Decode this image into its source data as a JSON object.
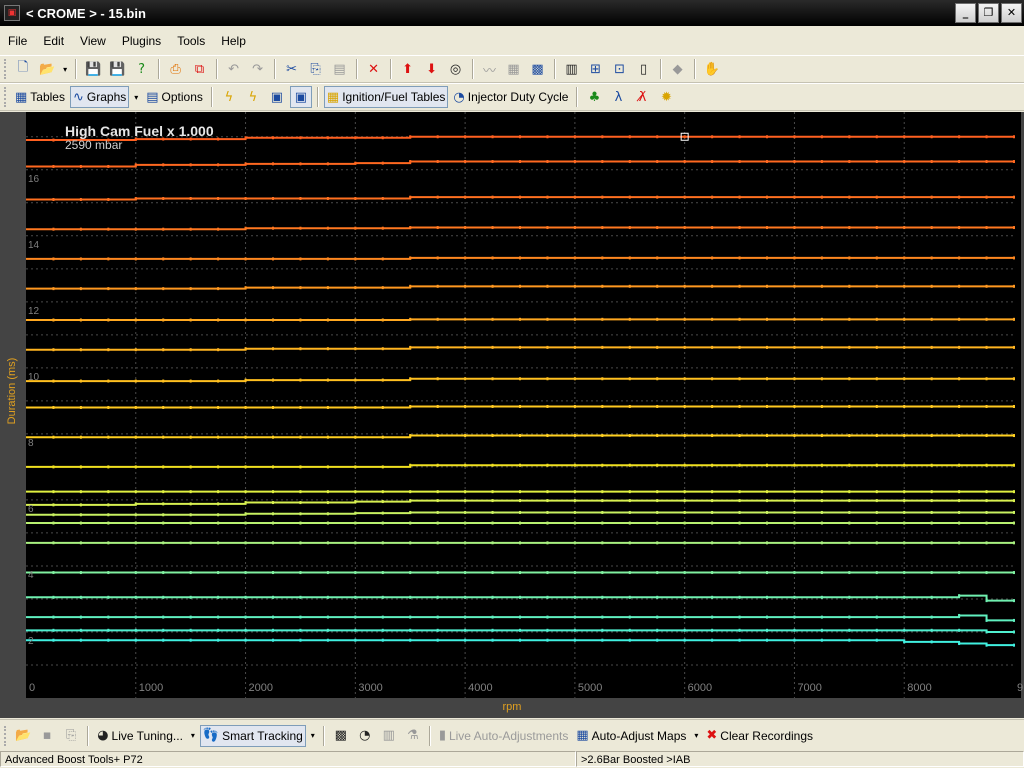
{
  "window": {
    "title": "< CROME > - 15.bin",
    "app_icon": "crome-app-icon",
    "buttons": [
      "_",
      "❐",
      "✕"
    ]
  },
  "menu": [
    "File",
    "Edit",
    "View",
    "Plugins",
    "Tools",
    "Help"
  ],
  "toolbar1": {
    "icons": [
      "new-file-icon",
      "open-folder-icon",
      "save-icon",
      "save-as-icon",
      "help-save-icon",
      "export-icon",
      "new-window-icon",
      "undo-icon",
      "redo-icon",
      "cut-icon",
      "copy-icon",
      "paste-icon",
      "delete-icon",
      "increase-icon",
      "decrease-icon",
      "target-icon",
      "smooth-icon",
      "interpolate-icon",
      "grid-icon",
      "chip-icon",
      "burn-icon",
      "emulate-icon",
      "checksum-icon",
      "eraser-icon",
      "hand-icon"
    ]
  },
  "toolbar2": {
    "tables_label": "Tables",
    "graphs_label": "Graphs",
    "options_label": "Options",
    "ignition_fuel_label": "Ignition/Fuel Tables",
    "injector_duty_label": "Injector Duty Cycle"
  },
  "graph": {
    "title": "High Cam Fuel x 1.000",
    "subtitle": "2590 mbar",
    "ylabel": "Duration (ms)",
    "xlabel": "rpm",
    "background": "#000000",
    "gridline_color": "#4a4a4a",
    "axis_label_color": "#e0a020",
    "tick_label_color": "#808080",
    "selected_marker_color": "#ffffff"
  },
  "chart_data": {
    "type": "line",
    "title": "High Cam Fuel x 1.000",
    "subtitle": "2590 mbar",
    "xlabel": "rpm",
    "ylabel": "Duration (ms)",
    "xlim": [
      0,
      9000
    ],
    "ylim": [
      0,
      17.5
    ],
    "x_ticks": [
      "0",
      "1000",
      "2000",
      "3000",
      "4000",
      "5000",
      "6000",
      "7000",
      "8000",
      "9"
    ],
    "y_ticks": [
      "2",
      "4",
      "6",
      "8",
      "10",
      "12",
      "14",
      "16"
    ],
    "grid": true,
    "x": [
      0,
      250,
      500,
      750,
      1000,
      1250,
      1500,
      1750,
      2000,
      2250,
      2500,
      2750,
      3000,
      3250,
      3500,
      3750,
      4000,
      4250,
      4500,
      4750,
      5000,
      5250,
      5500,
      5750,
      6000,
      6250,
      6500,
      6750,
      7000,
      7250,
      7500,
      7750,
      8000,
      8250,
      8500,
      8750,
      9000
    ],
    "series": [
      {
        "color": "#ff6020",
        "values": [
          16.9,
          16.9,
          16.9,
          16.9,
          16.93,
          16.93,
          16.93,
          16.93,
          16.97,
          16.97,
          16.97,
          16.97,
          16.97,
          16.97,
          17.0,
          17.0,
          17.0,
          17.0,
          17.0,
          17.0,
          17.0,
          17.0,
          17.0,
          17.0,
          17.0,
          17.0,
          17.0,
          17.0,
          17.0,
          17.0,
          17.0,
          17.0,
          17.0,
          17.0,
          17.0,
          17.0,
          17.0
        ]
      },
      {
        "color": "#ff6820",
        "values": [
          16.1,
          16.1,
          16.1,
          16.1,
          16.15,
          16.15,
          16.15,
          16.15,
          16.18,
          16.18,
          16.18,
          16.18,
          16.2,
          16.2,
          16.25,
          16.25,
          16.25,
          16.25,
          16.25,
          16.25,
          16.25,
          16.25,
          16.25,
          16.25,
          16.25,
          16.25,
          16.25,
          16.25,
          16.25,
          16.25,
          16.25,
          16.25,
          16.25,
          16.25,
          16.25,
          16.25,
          16.25
        ]
      },
      {
        "color": "#ff7020",
        "values": [
          15.1,
          15.1,
          15.1,
          15.1,
          15.13,
          15.13,
          15.13,
          15.13,
          15.13,
          15.13,
          15.13,
          15.13,
          15.13,
          15.13,
          15.17,
          15.17,
          15.17,
          15.17,
          15.17,
          15.17,
          15.17,
          15.17,
          15.17,
          15.17,
          15.17,
          15.17,
          15.17,
          15.17,
          15.17,
          15.17,
          15.17,
          15.17,
          15.17,
          15.17,
          15.17,
          15.17,
          15.17
        ]
      },
      {
        "color": "#ff7820",
        "values": [
          14.2,
          14.2,
          14.2,
          14.2,
          14.2,
          14.2,
          14.2,
          14.2,
          14.23,
          14.23,
          14.23,
          14.23,
          14.23,
          14.23,
          14.25,
          14.25,
          14.25,
          14.25,
          14.25,
          14.25,
          14.25,
          14.25,
          14.25,
          14.25,
          14.25,
          14.25,
          14.25,
          14.25,
          14.25,
          14.25,
          14.25,
          14.25,
          14.25,
          14.25,
          14.25,
          14.25,
          14.25
        ]
      },
      {
        "color": "#ff8820",
        "values": [
          13.3,
          13.3,
          13.3,
          13.3,
          13.3,
          13.3,
          13.3,
          13.3,
          13.3,
          13.3,
          13.3,
          13.3,
          13.3,
          13.3,
          13.33,
          13.33,
          13.33,
          13.33,
          13.33,
          13.33,
          13.33,
          13.33,
          13.33,
          13.33,
          13.33,
          13.33,
          13.33,
          13.33,
          13.33,
          13.33,
          13.33,
          13.33,
          13.33,
          13.33,
          13.33,
          13.33,
          13.33
        ]
      },
      {
        "color": "#ff9820",
        "values": [
          12.4,
          12.4,
          12.4,
          12.4,
          12.4,
          12.4,
          12.4,
          12.4,
          12.43,
          12.43,
          12.43,
          12.43,
          12.43,
          12.43,
          12.47,
          12.47,
          12.47,
          12.47,
          12.47,
          12.47,
          12.47,
          12.47,
          12.47,
          12.47,
          12.47,
          12.47,
          12.47,
          12.47,
          12.47,
          12.47,
          12.47,
          12.47,
          12.47,
          12.47,
          12.47,
          12.47,
          12.47
        ]
      },
      {
        "color": "#ffa820",
        "values": [
          11.45,
          11.45,
          11.45,
          11.45,
          11.45,
          11.45,
          11.45,
          11.45,
          11.45,
          11.45,
          11.45,
          11.45,
          11.45,
          11.45,
          11.47,
          11.47,
          11.47,
          11.47,
          11.47,
          11.47,
          11.47,
          11.47,
          11.47,
          11.47,
          11.47,
          11.47,
          11.47,
          11.47,
          11.47,
          11.47,
          11.47,
          11.47,
          11.47,
          11.47,
          11.47,
          11.47,
          11.47
        ]
      },
      {
        "color": "#ffb420",
        "values": [
          10.55,
          10.55,
          10.55,
          10.55,
          10.55,
          10.55,
          10.55,
          10.55,
          10.58,
          10.58,
          10.58,
          10.58,
          10.58,
          10.58,
          10.62,
          10.62,
          10.62,
          10.62,
          10.62,
          10.62,
          10.62,
          10.62,
          10.62,
          10.62,
          10.62,
          10.62,
          10.62,
          10.62,
          10.62,
          10.62,
          10.62,
          10.62,
          10.62,
          10.62,
          10.62,
          10.62,
          10.62
        ]
      },
      {
        "color": "#ffc020",
        "values": [
          9.6,
          9.6,
          9.6,
          9.6,
          9.6,
          9.6,
          9.6,
          9.6,
          9.63,
          9.63,
          9.63,
          9.63,
          9.63,
          9.63,
          9.67,
          9.67,
          9.67,
          9.67,
          9.67,
          9.67,
          9.67,
          9.67,
          9.67,
          9.67,
          9.67,
          9.67,
          9.67,
          9.67,
          9.67,
          9.67,
          9.67,
          9.67,
          9.67,
          9.67,
          9.67,
          9.67,
          9.67
        ]
      },
      {
        "color": "#ffc820",
        "values": [
          8.8,
          8.8,
          8.8,
          8.8,
          8.8,
          8.8,
          8.8,
          8.8,
          8.8,
          8.8,
          8.8,
          8.8,
          8.8,
          8.8,
          8.83,
          8.83,
          8.83,
          8.83,
          8.83,
          8.83,
          8.83,
          8.83,
          8.83,
          8.83,
          8.83,
          8.83,
          8.83,
          8.83,
          8.83,
          8.83,
          8.83,
          8.83,
          8.83,
          8.83,
          8.83,
          8.83,
          8.83
        ]
      },
      {
        "color": "#ffd020",
        "values": [
          7.9,
          7.9,
          7.9,
          7.9,
          7.9,
          7.9,
          7.9,
          7.9,
          7.9,
          7.9,
          7.9,
          7.9,
          7.9,
          7.9,
          7.95,
          7.95,
          7.95,
          7.95,
          7.95,
          7.95,
          7.95,
          7.95,
          7.95,
          7.95,
          7.95,
          7.95,
          7.95,
          7.95,
          7.95,
          7.95,
          7.95,
          7.95,
          7.95,
          7.95,
          7.95,
          7.95,
          7.95
        ]
      },
      {
        "color": "#f0e020",
        "values": [
          7.0,
          7.0,
          7.0,
          7.0,
          7.0,
          7.0,
          7.0,
          7.0,
          7.0,
          7.0,
          7.0,
          7.0,
          7.0,
          7.0,
          7.05,
          7.05,
          7.05,
          7.05,
          7.05,
          7.05,
          7.05,
          7.05,
          7.05,
          7.05,
          7.05,
          7.05,
          7.05,
          7.05,
          7.05,
          7.05,
          7.05,
          7.05,
          7.05,
          7.05,
          7.05,
          7.05,
          7.05
        ]
      },
      {
        "color": "#e0f040",
        "values": [
          6.25,
          6.25,
          6.25,
          6.25,
          6.25,
          6.25,
          6.25,
          6.25,
          6.25,
          6.25,
          6.25,
          6.25,
          6.25,
          6.25,
          6.25,
          6.25,
          6.25,
          6.25,
          6.25,
          6.25,
          6.25,
          6.25,
          6.25,
          6.25,
          6.25,
          6.25,
          6.25,
          6.25,
          6.25,
          6.25,
          6.25,
          6.25,
          6.25,
          6.25,
          6.25,
          6.25,
          6.25
        ]
      },
      {
        "color": "#d8f050",
        "values": [
          5.85,
          5.85,
          5.85,
          5.85,
          5.88,
          5.88,
          5.88,
          5.88,
          5.92,
          5.92,
          5.92,
          5.92,
          5.95,
          5.95,
          5.98,
          5.98,
          5.98,
          5.98,
          5.98,
          5.98,
          5.98,
          5.98,
          5.98,
          5.98,
          5.98,
          5.98,
          5.98,
          5.98,
          5.98,
          5.98,
          5.98,
          5.98,
          5.98,
          5.98,
          5.98,
          5.98,
          5.98
        ]
      },
      {
        "color": "#c8f060",
        "values": [
          5.55,
          5.55,
          5.55,
          5.55,
          5.55,
          5.55,
          5.55,
          5.55,
          5.58,
          5.58,
          5.58,
          5.58,
          5.6,
          5.6,
          5.62,
          5.62,
          5.62,
          5.62,
          5.62,
          5.62,
          5.62,
          5.62,
          5.62,
          5.62,
          5.62,
          5.62,
          5.62,
          5.62,
          5.62,
          5.62,
          5.62,
          5.62,
          5.62,
          5.62,
          5.62,
          5.62,
          5.62
        ]
      },
      {
        "color": "#b8f070",
        "values": [
          5.3,
          5.3,
          5.3,
          5.3,
          5.3,
          5.3,
          5.3,
          5.3,
          5.3,
          5.3,
          5.3,
          5.3,
          5.3,
          5.3,
          5.3,
          5.3,
          5.3,
          5.3,
          5.3,
          5.3,
          5.3,
          5.3,
          5.3,
          5.3,
          5.3,
          5.3,
          5.3,
          5.3,
          5.3,
          5.3,
          5.3,
          5.3,
          5.3,
          5.3,
          5.3,
          5.3,
          5.3
        ]
      },
      {
        "color": "#a8f080",
        "values": [
          4.7,
          4.7,
          4.7,
          4.7,
          4.7,
          4.7,
          4.7,
          4.7,
          4.7,
          4.7,
          4.7,
          4.7,
          4.7,
          4.7,
          4.7,
          4.7,
          4.7,
          4.7,
          4.7,
          4.7,
          4.7,
          4.7,
          4.7,
          4.7,
          4.7,
          4.7,
          4.7,
          4.7,
          4.7,
          4.7,
          4.7,
          4.7,
          4.7,
          4.7,
          4.7,
          4.7,
          4.7
        ]
      },
      {
        "color": "#80f0a0",
        "values": [
          3.8,
          3.8,
          3.8,
          3.8,
          3.8,
          3.8,
          3.8,
          3.8,
          3.8,
          3.8,
          3.8,
          3.8,
          3.8,
          3.8,
          3.8,
          3.8,
          3.8,
          3.8,
          3.8,
          3.8,
          3.8,
          3.8,
          3.8,
          3.8,
          3.8,
          3.8,
          3.8,
          3.8,
          3.8,
          3.8,
          3.8,
          3.8,
          3.8,
          3.8,
          3.8,
          3.8,
          3.8
        ]
      },
      {
        "color": "#70f0b0",
        "values": [
          3.05,
          3.05,
          3.05,
          3.05,
          3.05,
          3.05,
          3.05,
          3.05,
          3.05,
          3.05,
          3.05,
          3.05,
          3.05,
          3.05,
          3.05,
          3.05,
          3.05,
          3.05,
          3.05,
          3.05,
          3.05,
          3.05,
          3.05,
          3.05,
          3.05,
          3.05,
          3.05,
          3.05,
          3.05,
          3.05,
          3.05,
          3.05,
          3.05,
          3.05,
          3.1,
          2.95,
          2.95
        ]
      },
      {
        "color": "#60f0c0",
        "values": [
          2.45,
          2.45,
          2.45,
          2.45,
          2.45,
          2.45,
          2.45,
          2.45,
          2.45,
          2.45,
          2.45,
          2.45,
          2.45,
          2.45,
          2.45,
          2.45,
          2.45,
          2.45,
          2.45,
          2.45,
          2.45,
          2.45,
          2.45,
          2.45,
          2.45,
          2.45,
          2.45,
          2.45,
          2.45,
          2.45,
          2.45,
          2.45,
          2.45,
          2.45,
          2.5,
          2.35,
          2.35
        ]
      },
      {
        "color": "#50f0d0",
        "values": [
          2.05,
          2.05,
          2.05,
          2.05,
          2.05,
          2.05,
          2.05,
          2.05,
          2.05,
          2.05,
          2.05,
          2.05,
          2.05,
          2.05,
          2.05,
          2.05,
          2.05,
          2.05,
          2.05,
          2.05,
          2.05,
          2.05,
          2.05,
          2.05,
          2.05,
          2.05,
          2.05,
          2.05,
          2.05,
          2.05,
          2.05,
          2.05,
          2.05,
          2.05,
          2.05,
          2.0,
          2.0
        ]
      },
      {
        "color": "#40f0e0",
        "values": [
          1.75,
          1.75,
          1.75,
          1.75,
          1.75,
          1.75,
          1.75,
          1.75,
          1.75,
          1.75,
          1.75,
          1.75,
          1.75,
          1.75,
          1.75,
          1.75,
          1.75,
          1.75,
          1.75,
          1.75,
          1.75,
          1.75,
          1.75,
          1.75,
          1.75,
          1.75,
          1.75,
          1.75,
          1.75,
          1.75,
          1.75,
          1.75,
          1.7,
          1.7,
          1.65,
          1.6,
          1.6
        ]
      }
    ],
    "selected_point": {
      "x": 6000,
      "y": 17.0
    }
  },
  "bottom_toolbar": {
    "live_tuning_label": "Live Tuning...",
    "smart_tracking_label": "Smart Tracking",
    "live_auto_adjustments_label": "Live Auto-Adjustments",
    "auto_adjust_maps_label": "Auto-Adjust Maps",
    "clear_recordings_label": "Clear Recordings"
  },
  "status": {
    "left": "Advanced Boost Tools+ P72",
    "middle": "",
    "right": ">2.6Bar Boosted >IAB"
  }
}
